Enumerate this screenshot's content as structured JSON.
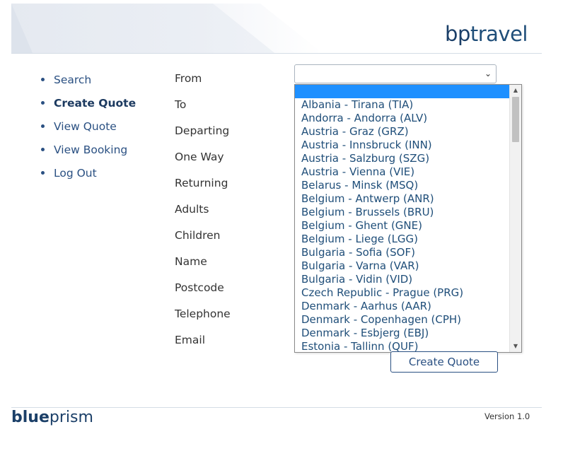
{
  "header": {
    "logo_bp": "bp",
    "logo_travel": "travel"
  },
  "nav": {
    "items": [
      {
        "label": "Search",
        "active": false
      },
      {
        "label": "Create Quote",
        "active": true
      },
      {
        "label": "View Quote",
        "active": false
      },
      {
        "label": "View Booking",
        "active": false
      },
      {
        "label": "Log Out",
        "active": false
      }
    ]
  },
  "form": {
    "labels": [
      "From",
      "To",
      "Departing",
      "One Way",
      "Returning",
      "Adults",
      "Children",
      "Name",
      "Postcode",
      "Telephone",
      "Email"
    ],
    "from_value": "",
    "from_options": [
      "Albania - Tirana (TIA)",
      "Andorra - Andorra (ALV)",
      "Austria - Graz (GRZ)",
      "Austria - Innsbruck (INN)",
      "Austria - Salzburg (SZG)",
      "Austria - Vienna (VIE)",
      "Belarus - Minsk (MSQ)",
      "Belgium - Antwerp (ANR)",
      "Belgium - Brussels (BRU)",
      "Belgium - Ghent (GNE)",
      "Belgium - Liege (LGG)",
      "Bulgaria - Sofia (SOF)",
      "Bulgaria - Varna (VAR)",
      "Bulgaria - Vidin (VID)",
      "Czech Republic - Prague (PRG)",
      "Denmark - Aarhus (AAR)",
      "Denmark - Copenhagen (CPH)",
      "Denmark - Esbjerg (EBJ)",
      "Estonia - Tallinn (QUF)"
    ],
    "submit_label": "Create Quote"
  },
  "footer": {
    "logo_blue": "blue",
    "logo_prism": "prism",
    "version": "Version 1.0"
  },
  "icons": {
    "select": "chevron-down-icon",
    "scroll_up": "triangle-up-icon",
    "scroll_down": "triangle-down-icon"
  },
  "colors": {
    "brand": "#1b3f68",
    "link": "#2a5082",
    "selection": "#1e90ff"
  }
}
